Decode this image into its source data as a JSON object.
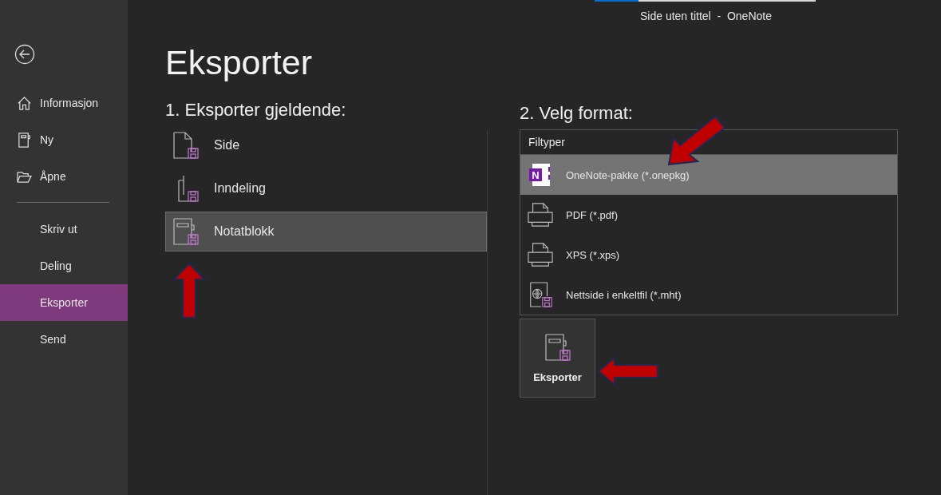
{
  "title_bar": {
    "title": "Side uten tittel  -  OneNote",
    "progress": {
      "level": 0.2
    }
  },
  "sidebar": {
    "primary": [
      {
        "label": "Informasjon",
        "selected": false
      },
      {
        "label": "Ny",
        "selected": false
      },
      {
        "label": "Åpne",
        "selected": false
      }
    ],
    "secondary": [
      {
        "label": "Skriv ut",
        "selected": false
      },
      {
        "label": "Deling",
        "selected": false
      },
      {
        "label": "Eksporter",
        "selected": true
      },
      {
        "label": "Send",
        "selected": false
      }
    ]
  },
  "page_title": "Eksporter",
  "scope": {
    "heading": "1. Eksporter gjeldende:",
    "options": [
      {
        "label": "Side",
        "selected": false
      },
      {
        "label": "Inndeling",
        "selected": false
      },
      {
        "label": "Notatblokk",
        "selected": true
      }
    ]
  },
  "format": {
    "heading": "2. Velg format:",
    "list_header": "Filtyper",
    "options": [
      {
        "label": "OneNote-pakke (*.onepkg)",
        "selected": true,
        "icon_letter": "N"
      },
      {
        "label": "PDF (*.pdf)",
        "selected": false
      },
      {
        "label": "XPS (*.xps)",
        "selected": false
      },
      {
        "label": "Nettside i enkeltfil (*.mht)",
        "selected": false
      }
    ]
  },
  "export_button": {
    "label": "Eksporter"
  }
}
